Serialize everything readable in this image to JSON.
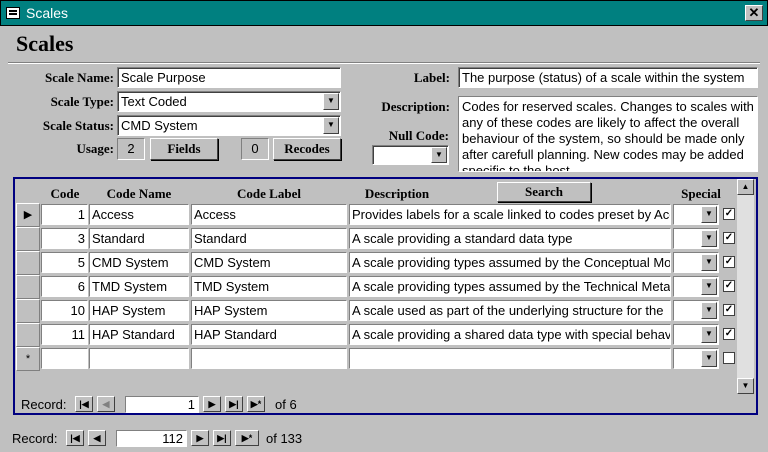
{
  "window": {
    "title": "Scales",
    "close_glyph": "✕"
  },
  "form": {
    "heading": "Scales",
    "scale_name": {
      "label": "Scale Name:",
      "value": "Scale Purpose"
    },
    "scale_type": {
      "label": "Scale Type:",
      "value": "Text Coded"
    },
    "scale_status": {
      "label": "Scale Status:",
      "value": "CMD System"
    },
    "usage": {
      "label": "Usage:",
      "value": "2",
      "fields_button": "Fields",
      "recodes_count": "0",
      "recodes_button": "Recodes"
    },
    "label_field": {
      "label": "Label:",
      "value": "The purpose (status) of a scale within the system"
    },
    "description": {
      "label": "Description:",
      "value": "Codes for reserved scales. Changes to scales with any of these codes are likely to affect the overall behaviour of the system, so should be made only after carefull planning. New codes may be added specific to the host"
    },
    "null_code": {
      "label": "Null Code:",
      "value": ""
    }
  },
  "subform": {
    "columns": [
      "Code",
      "Code Name",
      "Code Label",
      "Description",
      "Search",
      "Special"
    ],
    "rows": [
      {
        "code": "1",
        "name": "Access",
        "label": "Access",
        "description": "Provides labels for a scale linked to codes preset by Access",
        "special": "",
        "checked": "✓"
      },
      {
        "code": "3",
        "name": "Standard",
        "label": "Standard",
        "description": "A scale providing a standard data type",
        "special": "",
        "checked": "✓"
      },
      {
        "code": "5",
        "name": "CMD System",
        "label": "CMD System",
        "description": "A scale providing types assumed by the Conceptual Model",
        "special": "",
        "checked": "✓"
      },
      {
        "code": "6",
        "name": "TMD System",
        "label": "TMD System",
        "description": "A scale providing types assumed by the Technical Metadata",
        "special": "",
        "checked": "✓"
      },
      {
        "code": "10",
        "name": "HAP System",
        "label": "HAP System",
        "description": "A scale used as part of the underlying structure for the",
        "special": "",
        "checked": "✓"
      },
      {
        "code": "11",
        "name": "HAP Standard",
        "label": "HAP Standard",
        "description": "A scale providing a shared data type with special behaviour",
        "special": "",
        "checked": "✓"
      }
    ],
    "new_row_marker": "*",
    "navigation": {
      "label": "Record:",
      "current": "1",
      "of_text": "of 6"
    }
  },
  "navigation": {
    "label": "Record:",
    "current": "112",
    "of_text": "of 133"
  }
}
